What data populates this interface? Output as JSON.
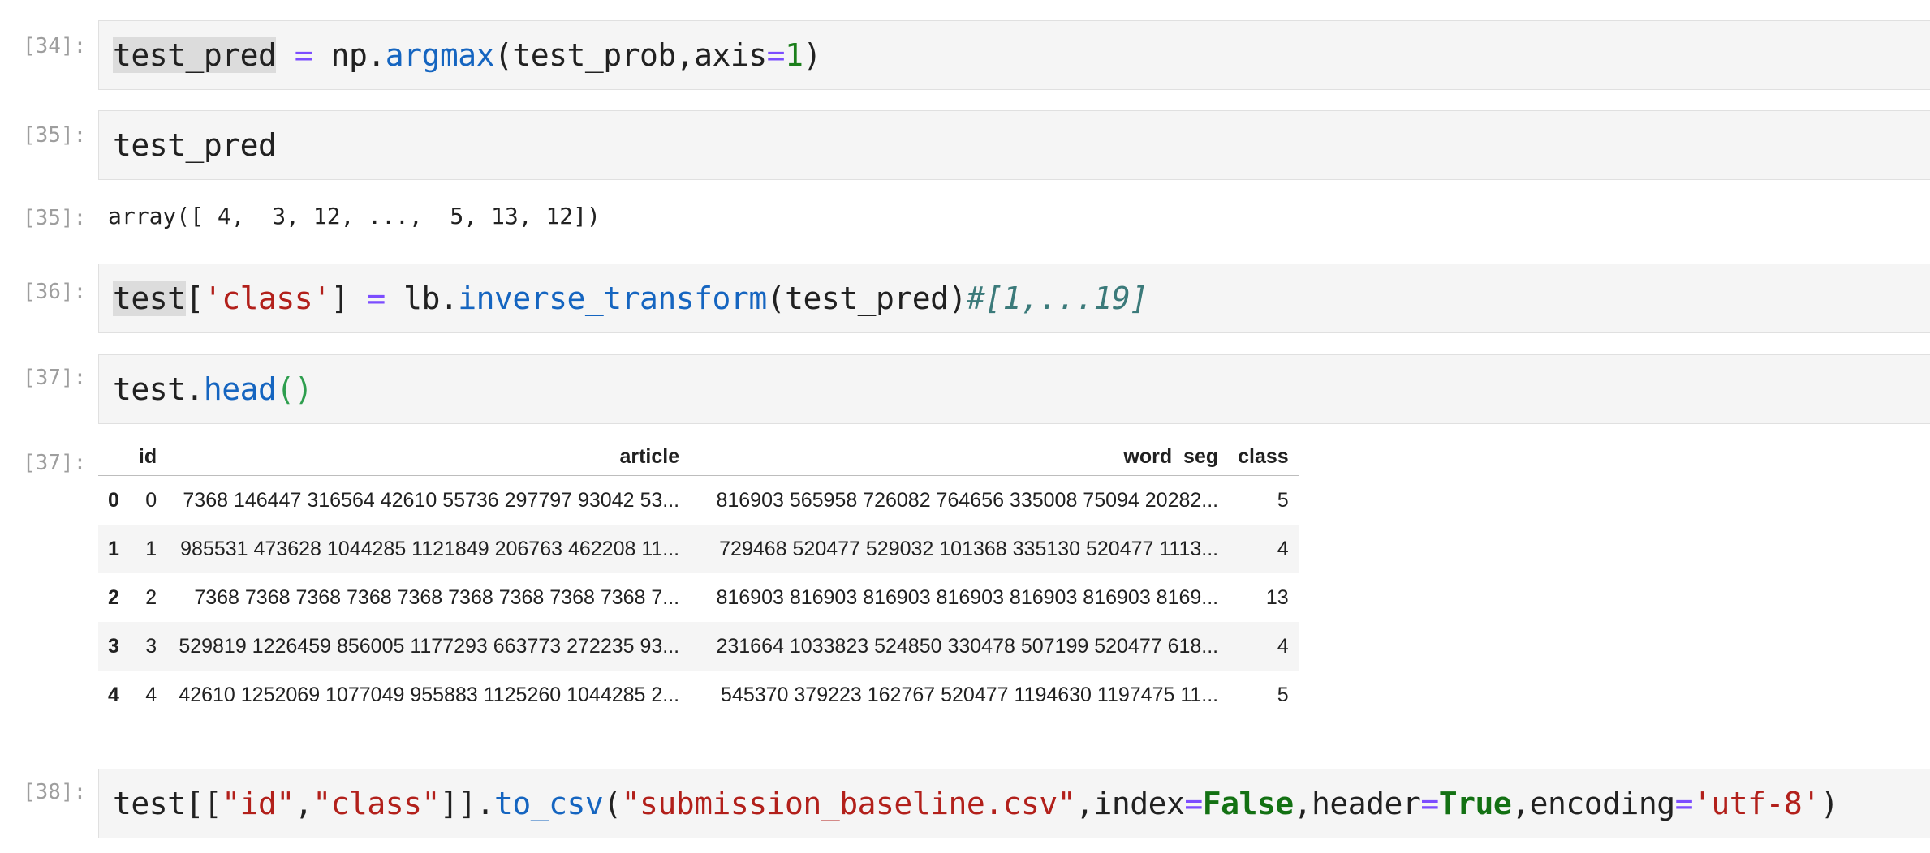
{
  "cells": [
    {
      "prompt": "[34]:",
      "code": {
        "v1": "test_pred",
        "op": "=",
        "mod": "np.",
        "fn": "argmax",
        "args": "(test_prob,axis",
        "eq": "=",
        "num": "1",
        "close": ")"
      }
    },
    {
      "prompt": "[35]:",
      "code": {
        "text": "test_pred"
      },
      "output_prompt": "[35]:",
      "output": "array([ 4,  3, 12, ...,  5, 13, 12])"
    },
    {
      "prompt": "[36]:",
      "code": {
        "v1": "test",
        "b1": "[",
        "s1": "'class'",
        "b2": "]",
        "op": "=",
        "mod": "lb.",
        "fn": "inverse_transform",
        "args": "(test_pred)",
        "comment": "#[1,...19]"
      }
    },
    {
      "prompt": "[37]:",
      "code": {
        "obj": "test.",
        "fn": "head",
        "paren": "()"
      },
      "output_prompt": "[37]:"
    },
    {
      "prompt": "[38]:",
      "code": {
        "p1": "test[[",
        "s1": "\"id\"",
        "c1": ",",
        "s2": "\"class\"",
        "p2": "]].",
        "fn": "to_csv",
        "p3": "(",
        "s3": "\"submission_baseline.csv\"",
        "c2": ",index",
        "e1": "=",
        "k1": "False",
        "c3": ",header",
        "e2": "=",
        "k2": "True",
        "c4": ",encoding",
        "e3": "=",
        "s4": "'utf-8'",
        "p4": ")"
      }
    }
  ],
  "dataframe": {
    "columns": [
      "",
      "id",
      "article",
      "word_seg",
      "class"
    ],
    "rows": [
      [
        "0",
        "0",
        "7368 146447 316564 42610 55736 297797 93042 53...",
        "816903 565958 726082 764656 335008 75094 20282...",
        "5"
      ],
      [
        "1",
        "1",
        "985531 473628 1044285 1121849 206763 462208 11...",
        "729468 520477 529032 101368 335130 520477 1113...",
        "4"
      ],
      [
        "2",
        "2",
        "7368 7368 7368 7368 7368 7368 7368 7368 7368 7...",
        "816903 816903 816903 816903 816903 816903 8169...",
        "13"
      ],
      [
        "3",
        "3",
        "529819 1226459 856005 1177293 663773 272235 93...",
        "231664 1033823 524850 330478 507199 520477 618...",
        "4"
      ],
      [
        "4",
        "4",
        "42610 1252069 1077049 955883 1125260 1044285 2...",
        "545370 379223 162767 520477 1194630 1197475 11...",
        "5"
      ]
    ]
  }
}
